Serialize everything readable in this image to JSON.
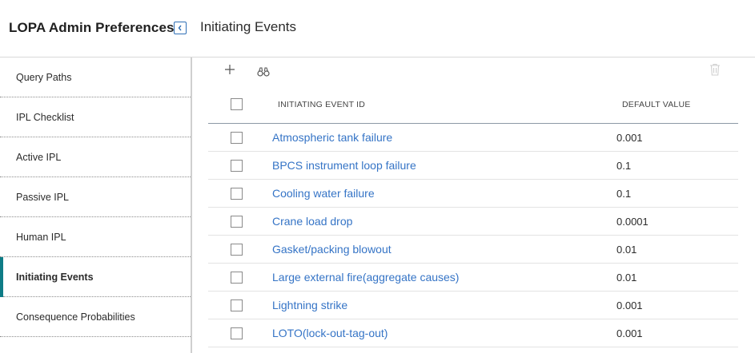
{
  "header": {
    "app_title": "LOPA Admin Preferences",
    "page_title": "Initiating Events"
  },
  "sidebar": {
    "items": [
      {
        "label": "Query Paths"
      },
      {
        "label": "IPL Checklist"
      },
      {
        "label": "Active IPL"
      },
      {
        "label": "Passive IPL"
      },
      {
        "label": "Human IPL"
      },
      {
        "label": "Initiating Events",
        "active": true
      },
      {
        "label": "Consequence Probabilities"
      }
    ]
  },
  "toolbar": {
    "add_icon": "plus-icon",
    "search_icon": "binoculars-icon",
    "delete_icon": "trash-icon"
  },
  "table": {
    "columns": [
      "INITIATING EVENT ID",
      "DEFAULT VALUE"
    ],
    "rows": [
      {
        "id": "Atmospheric tank failure",
        "value": "0.001"
      },
      {
        "id": "BPCS instrument loop failure",
        "value": "0.1"
      },
      {
        "id": "Cooling water failure",
        "value": "0.1"
      },
      {
        "id": "Crane load drop",
        "value": "0.0001"
      },
      {
        "id": "Gasket/packing blowout",
        "value": "0.01"
      },
      {
        "id": "Large external fire(aggregate causes)",
        "value": "0.01"
      },
      {
        "id": "Lightning strike",
        "value": "0.001"
      },
      {
        "id": "LOTO(lock-out-tag-out)",
        "value": "0.001"
      }
    ]
  },
  "colors": {
    "link": "#3574c6",
    "accent": "#0e7c86",
    "collapse_button": "#2f6fb5"
  }
}
